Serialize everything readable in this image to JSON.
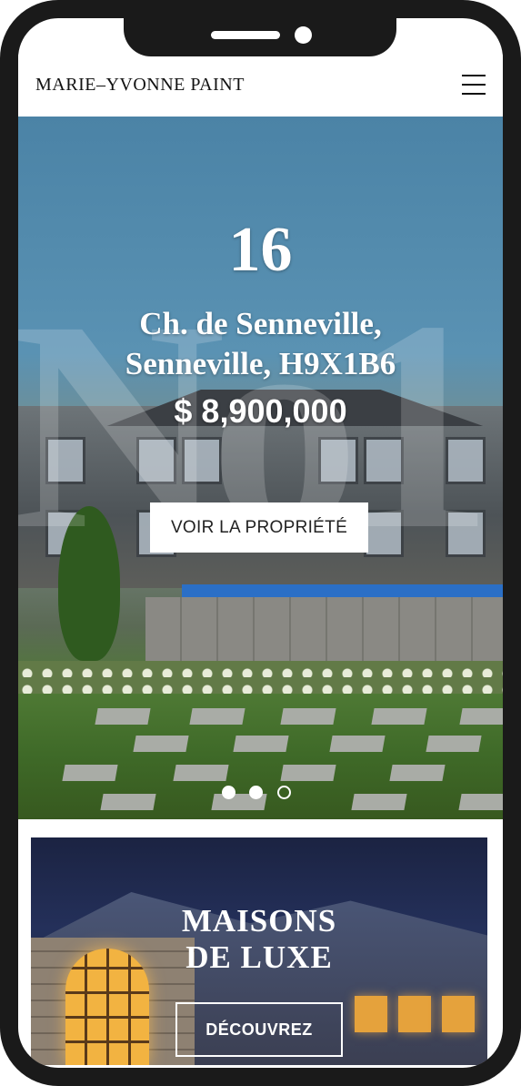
{
  "header": {
    "logo": "MARIE–YVONNE PAINT",
    "menu_icon": "hamburger-menu-icon"
  },
  "hero": {
    "background_word": "No1",
    "street_number": "16",
    "address_line1": "Ch. de Senneville,",
    "address_line2": "Senneville, H9X1B6",
    "price": "$ 8,900,000",
    "cta_label": "VOIR LA PROPRIÉTÉ",
    "carousel": {
      "total": 3,
      "active": 3
    }
  },
  "luxury": {
    "title_line1": "MAISONS",
    "title_line2": "DE LUXE",
    "button_label": "DÉCOUVREZ"
  }
}
